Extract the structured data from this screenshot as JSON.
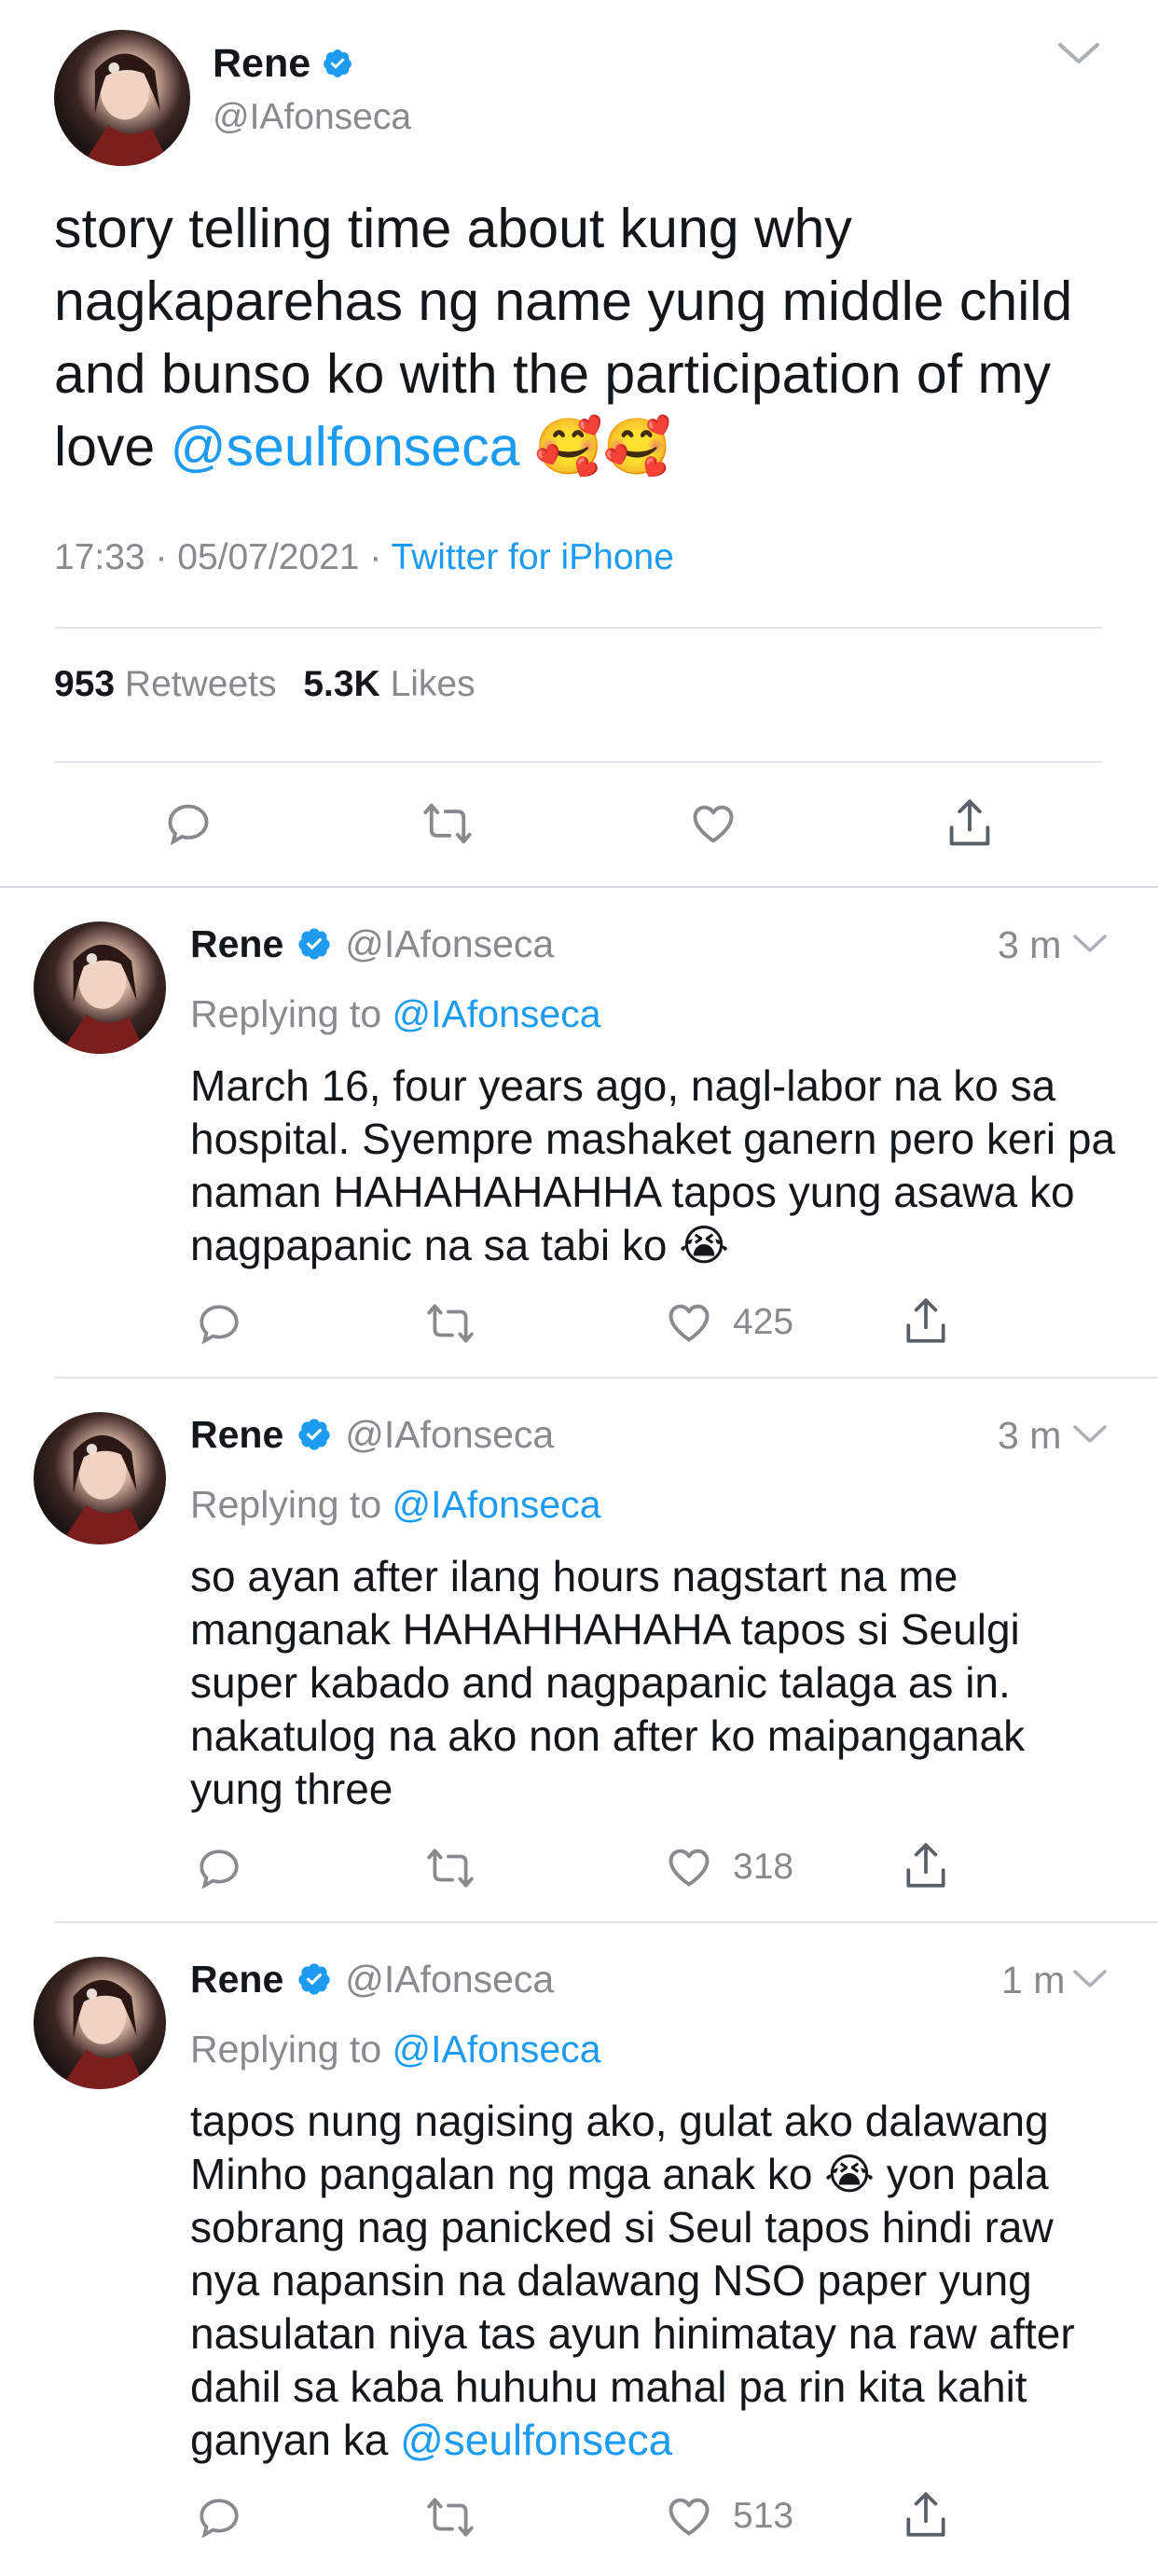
{
  "main": {
    "name": "Rene",
    "handle": "@IAfonseca",
    "text": "story telling time about kung why nagkaparehas ng name yung middle child and bunso ko with the participation of my love ",
    "mention": "@seulfonseca",
    "emoji": "🥰🥰",
    "time": "17:33",
    "date": "05/07/2021",
    "source": "Twitter for iPhone",
    "retweets_count": "953",
    "retweets_label": "Retweets",
    "likes_count": "5.3K",
    "likes_label": "Likes"
  },
  "replies": [
    {
      "name": "Rene",
      "handle": "@IAfonseca",
      "time": "3 m",
      "replying_label": "Replying to",
      "replying_to": "@IAfonseca",
      "text": "March 16, four years ago, nagl-labor na ko sa hospital. Syempre mashaket ganern pero keri pa naman HAHAHAHAHHA tapos yung asawa ko nagpapanic na sa tabi ko ",
      "emoji": "😭",
      "likes": "425"
    },
    {
      "name": "Rene",
      "handle": "@IAfonseca",
      "time": "3 m",
      "replying_label": "Replying to",
      "replying_to": "@IAfonseca",
      "text": "so ayan after ilang hours nagstart na me manganak HAHAHHAHAHA tapos si Seulgi super kabado and nagpapanic talaga as in. nakatulog na ako non after ko maipanganak yung three",
      "likes": "318"
    },
    {
      "name": "Rene",
      "handle": "@IAfonseca",
      "time": "1 m",
      "replying_label": "Replying to",
      "replying_to": "@IAfonseca",
      "text_a": "tapos nung nagising ako, gulat ako dalawang Minho pangalan ng mga anak ko ",
      "emoji": "😭",
      "text_b": " yon pala sobrang nag panicked si Seul tapos hindi raw nya napansin na dalawang NSO paper yung nasulatan niya tas ayun hinimatay na raw after dahil sa kaba huhuhu mahal pa rin kita kahit ganyan ka ",
      "mention": "@seulfonseca",
      "likes": "513"
    }
  ],
  "icons": {
    "verified": "verified-badge-icon",
    "chevron": "chevron-down-icon",
    "reply": "reply-icon",
    "retweet": "retweet-icon",
    "like": "heart-icon",
    "share": "share-icon"
  },
  "colors": {
    "accent": "#1d9bf0",
    "muted": "#8a8a8e",
    "text": "#14171a",
    "divider": "#e1e4e8"
  }
}
